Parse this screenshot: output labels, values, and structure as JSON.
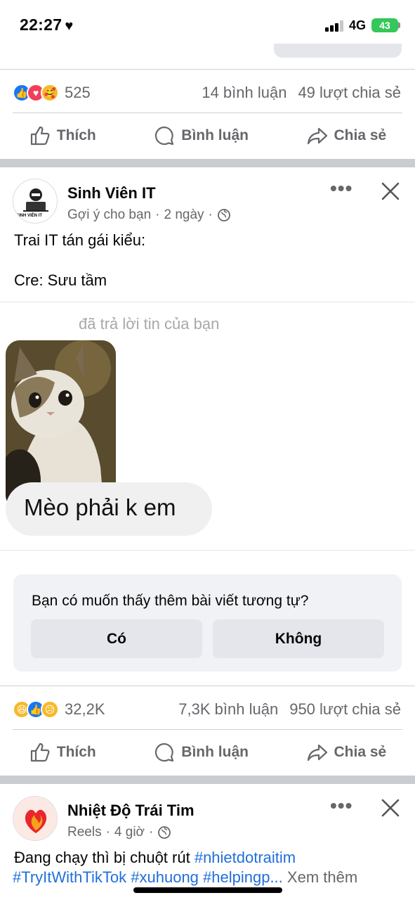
{
  "status_bar": {
    "time": "22:27",
    "network": "4G",
    "battery": "43"
  },
  "post1": {
    "reaction_count": "525",
    "comments": "14 bình luận",
    "shares": "49 lượt chia sẻ"
  },
  "actions": {
    "like": "Thích",
    "comment": "Bình luận",
    "share": "Chia sẻ"
  },
  "post2": {
    "page_name": "Sinh Viên IT",
    "avatar_caption": "SINH VIÊN IT",
    "meta_label": "Gợi ý cho bạn",
    "time": "2 ngày",
    "text_line1": "Trai IT tán gái kiểu:",
    "text_line2": "Cre: Sưu tầm",
    "meme_reply_label": "đã trả lời tin của bạn",
    "meme_message": "Mèo phải k em",
    "survey": {
      "question": "Bạn có muốn thấy thêm bài viết tương tự?",
      "yes": "Có",
      "no": "Không"
    },
    "reaction_count": "32,2K",
    "comments": "7,3K bình luận",
    "shares": "950 lượt chia sẻ"
  },
  "post3": {
    "page_name": "Nhiệt Độ Trái Tim",
    "meta_label": "Reels",
    "time": "4 giờ",
    "text_start": "Đang chạy thì bị chuột rút",
    "hashtag_1": "#nhietdotraitim",
    "hashtags_line2": "#TryItWithTikTok #xuhuong #helpingp...",
    "see_more": "Xem thêm"
  },
  "colors": {
    "accent": "#1877f2",
    "love": "#f33e58",
    "haha": "#f7b928",
    "muted": "#65676b",
    "battery": "#34c759"
  }
}
